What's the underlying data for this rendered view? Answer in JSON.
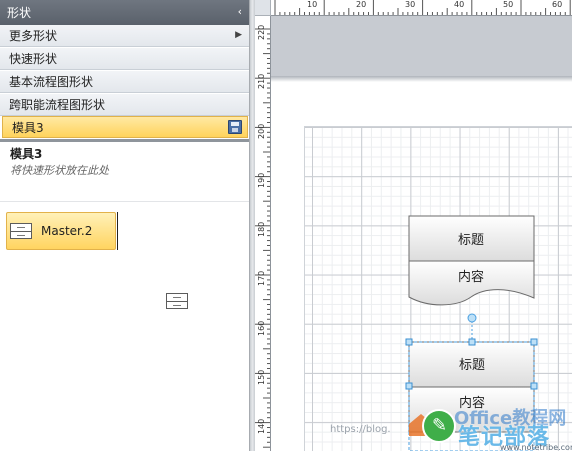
{
  "shapes_pane": {
    "title": "形状",
    "collapse_glyph": "‹",
    "menu": [
      {
        "label": "更多形状",
        "submenu_glyph": "▶"
      },
      {
        "label": "快速形状"
      },
      {
        "label": "基本流程图形状"
      },
      {
        "label": "跨职能流程图形状"
      },
      {
        "label": "模具3",
        "active": true
      }
    ],
    "stencil": {
      "name": "模具3",
      "hint": "将快速形状放在此处",
      "masters": [
        {
          "label": "Master.2"
        }
      ]
    }
  },
  "ruler_horizontal": {
    "labels": [
      "10",
      "20",
      "30",
      "40",
      "50",
      "60"
    ]
  },
  "ruler_vertical": {
    "labels": [
      "220",
      "210",
      "200",
      "190",
      "180",
      "170",
      "160",
      "150",
      "140"
    ]
  },
  "canvas": {
    "shapes": [
      {
        "title": "标题",
        "content": "内容",
        "selected": false
      },
      {
        "title": "标题",
        "content": "内容",
        "selected": true
      }
    ]
  },
  "watermark": {
    "url": "https://blog.",
    "brand_top": "Office教程网",
    "brand_main": "笔记部落",
    "brand_url": "www.notetribe.com"
  },
  "colors": {
    "active_row": "#ffd35c",
    "pane_header": "#5a616b",
    "selection_handle": "#4a9fe0"
  }
}
